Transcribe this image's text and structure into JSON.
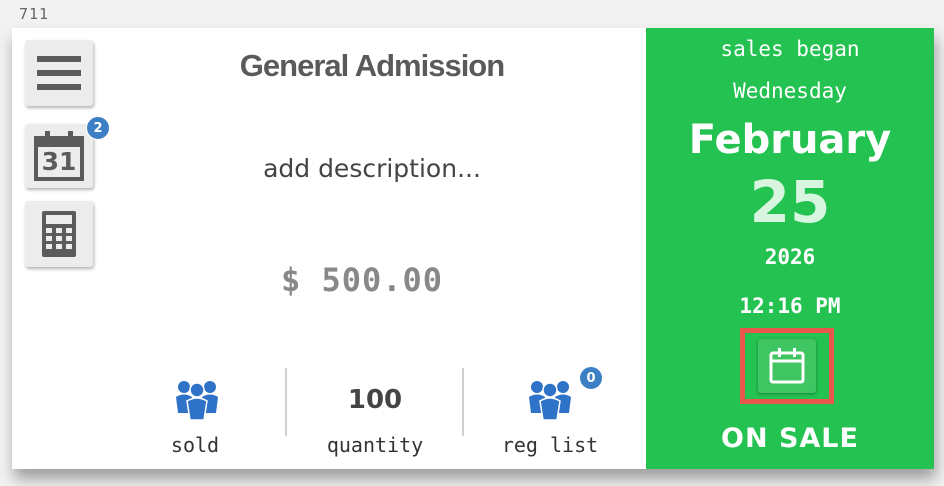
{
  "card_id": "711",
  "ticket": {
    "title": "General Admission",
    "description_placeholder": "add description...",
    "price": "$ 500.00"
  },
  "toolbar": {
    "menu_icon": "hamburger-menu-icon",
    "calendar_icon": "calendar-31-icon",
    "calendar_day": "31",
    "calendar_badge": "2",
    "calculator_icon": "calculator-icon"
  },
  "stats": {
    "sold_label": "sold",
    "quantity_value": "100",
    "quantity_label": "quantity",
    "reg_list_label": "reg list",
    "reg_list_badge": "0"
  },
  "sales": {
    "began_label": "sales began",
    "weekday": "Wednesday",
    "month": "February",
    "day": "25",
    "year": "2026",
    "time": "12:16 PM",
    "status": "ON SALE",
    "status_icon": "calendar-icon"
  },
  "colors": {
    "panel_green": "#24c251",
    "badge_blue": "#3d7fc4",
    "people_icon_blue": "#2f73c8",
    "highlight_red": "#e8574a"
  }
}
